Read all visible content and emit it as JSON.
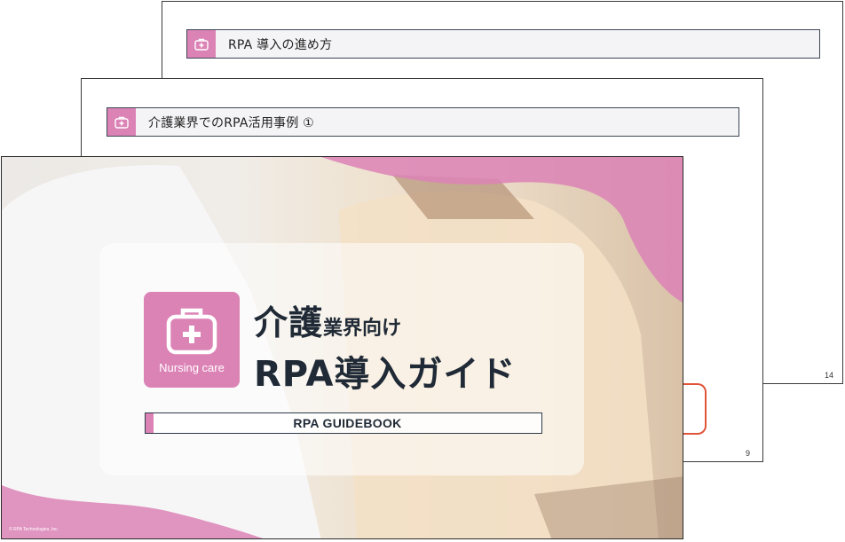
{
  "slides": {
    "back": {
      "title": "RPA 導入の進め方",
      "page_number": "14"
    },
    "middle": {
      "title": "介護業界でのRPA活用事例 ①",
      "page_number": "9"
    },
    "front": {
      "badge_label": "Nursing care",
      "title_big": "介護",
      "title_small": "業界向け",
      "title_line2": "RPA導入ガイド",
      "subtitle": "RPA GUIDEBOOK",
      "copyright": "© RPA Technologies, Inc."
    }
  },
  "colors": {
    "accent_pink": "#dc83b6",
    "title_navy": "#1f2a36",
    "orange": "#e0553a"
  },
  "icons": {
    "header": "medical-kit-icon",
    "badge": "medical-kit-icon"
  }
}
